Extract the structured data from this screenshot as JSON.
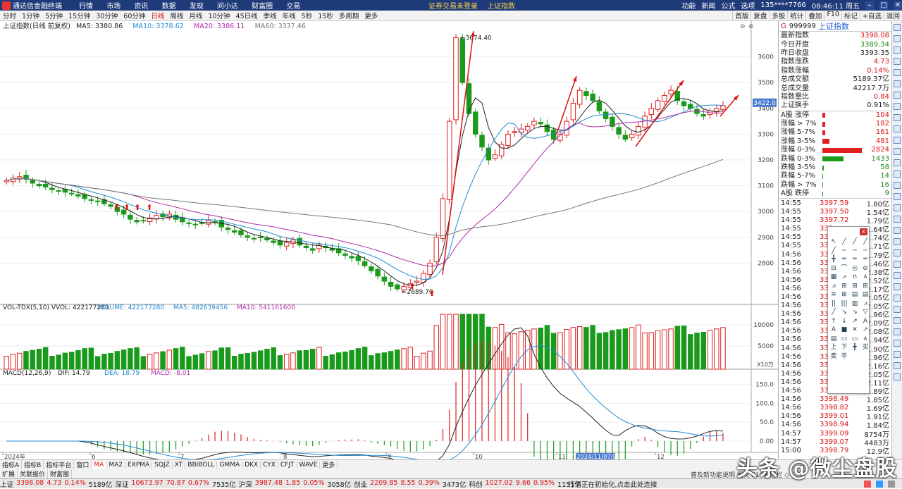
{
  "titlebar": {
    "app_name": "通达信金融终端",
    "menu": [
      "行情",
      "市场",
      "资讯",
      "数据",
      "发现",
      "问小达",
      "财富圈",
      "交易"
    ],
    "notices": [
      "证券交易未登录",
      "上证指数"
    ],
    "right_items": [
      "功能",
      "新闻",
      "公式",
      "选项",
      "135****7766",
      "08:46:11 周五"
    ]
  },
  "toolbar": {
    "periods": [
      "分时",
      "1分钟",
      "5分钟",
      "15分钟",
      "30分钟",
      "60分钟",
      "日线",
      "周线",
      "月线",
      "10分钟",
      "45日线",
      "季线",
      "年线",
      "5秒",
      "15秒",
      "多周期",
      "更多"
    ],
    "active_period": "日线",
    "right": [
      "首版",
      "复盘",
      "多股",
      "统计",
      "叠加",
      "F10",
      "标记",
      "+自选",
      "返回"
    ]
  },
  "chart": {
    "title": "上证指数(日线 前复权)",
    "ma": [
      {
        "label": "MA5: 3380.86",
        "color": "#222222"
      },
      {
        "label": "MA10: 3378.62",
        "color": "#1e8bd6"
      },
      {
        "label": "MA20: 3386.11",
        "color": "#b02aa8"
      },
      {
        "label": "MA60: 3337.46",
        "color": "#777777"
      }
    ],
    "price_ticks": [
      "3600",
      "3500",
      "3400",
      "3300",
      "3200",
      "3100",
      "3000",
      "2900",
      "2800"
    ],
    "current_price_tag": "3422.0",
    "high_label": "3674.40",
    "low_label": "2689.70",
    "volume_title": "VOL-TDX(5,10) VVOL: 422177280",
    "volume_items": [
      {
        "label": "VOLUME: 422177280",
        "color": "#1e8bd6"
      },
      {
        "label": "MA5: 482639456",
        "color": "#1e8bd6"
      },
      {
        "label": "MA10: 541161600",
        "color": "#b02aa8"
      }
    ],
    "volume_ticks": [
      "10000",
      "5000"
    ],
    "volume_unit": "X10万",
    "macd_title": "MACD(12,26,9)",
    "macd_items": [
      {
        "label": "DIF: 14.79",
        "color": "#222222"
      },
      {
        "label": "DEA: 18.79",
        "color": "#1e8bd6"
      },
      {
        "label": "MACD: -8.01",
        "color": "#b02aa8"
      }
    ],
    "macd_ticks": [
      "150.0",
      "100.0",
      "50.0",
      "0.00"
    ],
    "x_labels": [
      "2024年",
      "6",
      "7",
      "8",
      "9",
      "10",
      "11",
      "2024/11/07/四",
      "12"
    ]
  },
  "chart_data": {
    "type": "candlestick",
    "title": "上证指数(日线 前复权)",
    "price_range": [
      2640,
      3700
    ],
    "markers": {
      "high": 3674.4,
      "low": 2689.7,
      "current": 3422.0
    },
    "volume_unit": "X10万",
    "macd_range": [
      -30,
      170
    ],
    "close_path_estimate": [
      3120,
      3130,
      3135,
      3125,
      3110,
      3100,
      3095,
      3085,
      3080,
      3075,
      3070,
      3060,
      3050,
      3045,
      3040,
      3030,
      3020,
      3000,
      2990,
      2970,
      2960,
      2965,
      2975,
      2985,
      2980,
      2990,
      2970,
      2960,
      2955,
      2950,
      2955,
      2965,
      2960,
      2940,
      2930,
      2920,
      2910,
      2900,
      2895,
      2900,
      2890,
      2880,
      2870,
      2880,
      2890,
      2870,
      2860,
      2850,
      2870,
      2860,
      2850,
      2840,
      2830,
      2820,
      2810,
      2790,
      2770,
      2750,
      2730,
      2710,
      2700,
      2710,
      2720,
      2730,
      2760,
      2800,
      2900,
      3050,
      3350,
      3674,
      3500,
      3380,
      3300,
      3250,
      3200,
      3220,
      3260,
      3300,
      3310,
      3320,
      3330,
      3350,
      3340,
      3310,
      3280,
      3300,
      3350,
      3420,
      3470,
      3450,
      3430,
      3390,
      3360,
      3330,
      3300,
      3280,
      3300,
      3330,
      3370,
      3400,
      3430,
      3450,
      3470,
      3430,
      3410,
      3400,
      3380,
      3370,
      3390,
      3400,
      3410
    ]
  },
  "panel": {
    "marker": "G",
    "code": "999999",
    "name": "上证指数",
    "stats": [
      {
        "k": "最新指数",
        "v": "3398.08",
        "c": "red"
      },
      {
        "k": "今日开盘",
        "v": "3389.34",
        "c": "green"
      },
      {
        "k": "昨日收盘",
        "v": "3393.35",
        "c": "blk"
      },
      {
        "k": "指数涨跌",
        "v": "4.73",
        "c": "red"
      },
      {
        "k": "指数涨幅",
        "v": "0.14%",
        "c": "red"
      },
      {
        "k": "总成交额",
        "v": "5189.37亿",
        "c": "blk"
      },
      {
        "k": "总成交量",
        "v": "42217.7万",
        "c": "blk"
      },
      {
        "k": "指数量比",
        "v": "0.84",
        "c": "red"
      },
      {
        "k": "上证换手",
        "v": "0.91%",
        "c": "blk"
      }
    ],
    "breadth": [
      {
        "k": "A股 涨停",
        "v": "104",
        "bar": 4,
        "c": "red"
      },
      {
        "k": "涨幅 > 7%",
        "v": "182",
        "bar": 4,
        "c": "red"
      },
      {
        "k": "涨幅 5-7%",
        "v": "161",
        "bar": 4,
        "c": "red"
      },
      {
        "k": "涨幅 3-5%",
        "v": "481",
        "bar": 10,
        "c": "red"
      },
      {
        "k": "涨幅 0-3%",
        "v": "2824",
        "bar": 56,
        "c": "red"
      },
      {
        "k": "跌幅 0-3%",
        "v": "1433",
        "bar": 30,
        "c": "green"
      },
      {
        "k": "跌幅 3-5%",
        "v": "58",
        "bar": 2,
        "c": "green"
      },
      {
        "k": "跌幅 5-7%",
        "v": "14",
        "bar": 1,
        "c": "green"
      },
      {
        "k": "跌幅 > 7%",
        "v": "16",
        "bar": 1,
        "c": "green"
      },
      {
        "k": "A股 跌停",
        "v": "9",
        "bar": 1,
        "c": "green"
      }
    ],
    "ticks": [
      {
        "t": "14:55",
        "p": "3397.59",
        "a": "1.80亿"
      },
      {
        "t": "14:55",
        "p": "3397.50",
        "a": "1.54亿"
      },
      {
        "t": "14:55",
        "p": "3397.72",
        "a": "1.79亿"
      },
      {
        "t": "14:55",
        "p": "339",
        "a": "1.64亿"
      },
      {
        "t": "14:55",
        "p": "339",
        "a": "1.74亿"
      },
      {
        "t": "14:55",
        "p": "339",
        "a": "1.71亿"
      },
      {
        "t": "14:56",
        "p": "339",
        "a": "1.79亿"
      },
      {
        "t": "14:56",
        "p": "339",
        "a": "1.46亿"
      },
      {
        "t": "14:56",
        "p": "339",
        "a": "2.38亿"
      },
      {
        "t": "14:56",
        "p": "339",
        "a": "2.52亿"
      },
      {
        "t": "14:56",
        "p": "339",
        "a": "2.17亿"
      },
      {
        "t": "14:56",
        "p": "339",
        "a": "2.05亿"
      },
      {
        "t": "14:56",
        "p": "339",
        "a": "2.05亿"
      },
      {
        "t": "14:56",
        "p": "339",
        "a": "1.96亿"
      },
      {
        "t": "14:56",
        "p": "339",
        "a": "2.09亿"
      },
      {
        "t": "14:56",
        "p": "339",
        "a": "2.08亿"
      },
      {
        "t": "14:56",
        "p": "339",
        "a": "1.94亿"
      },
      {
        "t": "14:56",
        "p": "339",
        "a": "1.90亿"
      },
      {
        "t": "14:56",
        "p": "339",
        "a": "1.96亿"
      },
      {
        "t": "14:56",
        "p": "339",
        "a": "2.16亿"
      },
      {
        "t": "14:56",
        "p": "339",
        "a": "2.05亿"
      },
      {
        "t": "14:56",
        "p": "339",
        "a": "2.11亿"
      },
      {
        "t": "14:56",
        "p": "339",
        "a": "1.89亿"
      },
      {
        "t": "14:56",
        "p": "3398.49",
        "a": "1.85亿"
      },
      {
        "t": "14:56",
        "p": "3398.82",
        "a": "1.69亿"
      },
      {
        "t": "14:56",
        "p": "3399.01",
        "a": "1.91亿"
      },
      {
        "t": "14:56",
        "p": "3398.94",
        "a": "1.84亿"
      },
      {
        "t": "14:57",
        "p": "3399.09",
        "a": "8754万"
      },
      {
        "t": "14:57",
        "p": "3399.07",
        "a": "4483万"
      },
      {
        "t": "15:00",
        "p": "3398.79",
        "a": "12.9亿"
      }
    ]
  },
  "drawtools": {
    "close": "x",
    "icons": [
      "↖",
      "╱",
      "╱",
      "╱",
      "╱",
      "─",
      "─",
      "─",
      "╋",
      "═",
      "═",
      "═",
      "⊟",
      "⌒",
      "◎",
      "⊘",
      "▦",
      "⩘",
      "∩",
      "∧",
      "⩘",
      "⊞",
      "⊞",
      "⊞",
      "≡",
      "⊞",
      "▤",
      "▤",
      "||",
      "|||",
      "▥",
      "⩘",
      "╱",
      "↘",
      "↘",
      "▽",
      "↑",
      "↓",
      "↗",
      "A",
      "A",
      "■",
      "✕",
      "↗",
      "▤",
      "▭",
      "▭",
      "∧",
      "上",
      "下",
      "╋",
      "买",
      "卖",
      "平"
    ]
  },
  "bottomtabs": {
    "row1": [
      "指标A",
      "指标B",
      "指标平台",
      "窗口",
      "MA",
      "MA2",
      "EXPMA",
      "SQJZ",
      "XT",
      "BBIBOLL",
      "GMMA",
      "DKX",
      "CYX",
      "CFJT",
      "WAVE",
      "更多"
    ],
    "active": "MA",
    "row2": [
      "扩展",
      "关联报价",
      "财富圈"
    ],
    "notice": "普及新功能说明 图文 F10测边栏 ◇"
  },
  "statusbar": {
    "items": [
      {
        "t": "上证",
        "c": "blk"
      },
      {
        "t": "3398.08",
        "c": "red"
      },
      {
        "t": "4.73",
        "c": "red"
      },
      {
        "t": "0.14%",
        "c": "red"
      },
      {
        "t": "5189亿",
        "c": "blk"
      },
      {
        "t": "深证",
        "c": "blk"
      },
      {
        "t": "10673.97",
        "c": "red"
      },
      {
        "t": "70.87",
        "c": "red"
      },
      {
        "t": "0.67%",
        "c": "red"
      },
      {
        "t": "7535亿",
        "c": "blk"
      },
      {
        "t": "沪深",
        "c": "blk"
      },
      {
        "t": "3987.48",
        "c": "red"
      },
      {
        "t": "1.85",
        "c": "red"
      },
      {
        "t": "0.05%",
        "c": "red"
      },
      {
        "t": "3058亿",
        "c": "blk"
      },
      {
        "t": "创业",
        "c": "blk"
      },
      {
        "t": "2209.85",
        "c": "red"
      },
      {
        "t": "8.55",
        "c": "red"
      },
      {
        "t": "0.39%",
        "c": "red"
      },
      {
        "t": "3473亿",
        "c": "blk"
      },
      {
        "t": "科创",
        "c": "blk"
      },
      {
        "t": "1027.02",
        "c": "red"
      },
      {
        "t": "9.66",
        "c": "red"
      },
      {
        "t": "0.95%",
        "c": "red"
      },
      {
        "t": "1151亿",
        "c": "blk"
      }
    ],
    "message": "行情正在初始化,点击此处连接",
    "watermark": "头条 @微尘盘股"
  }
}
